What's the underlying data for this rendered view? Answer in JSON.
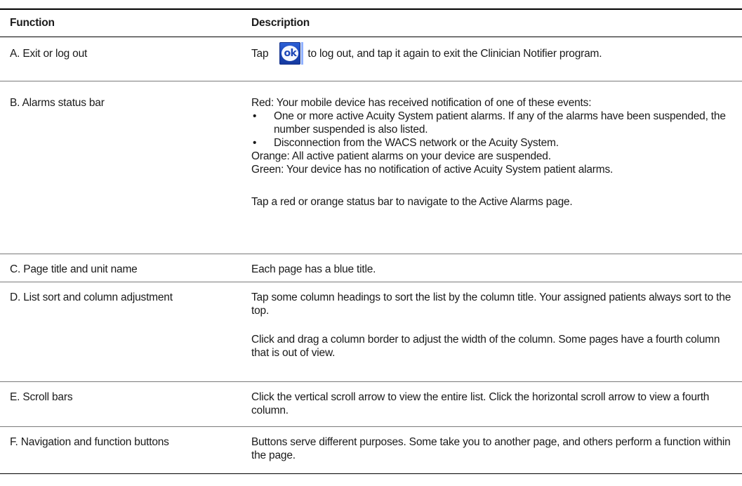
{
  "table": {
    "headers": {
      "function": "Function",
      "description": "Description"
    },
    "rows": [
      {
        "function": "A. Exit or log out",
        "desc_before": "Tap",
        "button_label": "ok",
        "desc_after": "to log out, and tap it again to exit the Clinician Notifier program."
      },
      {
        "function": "B. Alarms status bar",
        "intro": "Red: Your mobile device has received notification of one of these events:",
        "bullet_char": "•",
        "bullets": [
          "One or more active Acuity System patient alarms. If any of the alarms have been suspended, the number suspended is also listed.",
          "Disconnection from the WACS network or the Acuity System."
        ],
        "orange": "Orange: All active patient alarms on your device are suspended.",
        "green": "Green: Your device has no notification of active Acuity System patient alarms.",
        "tap_note": "Tap a red or orange status bar to navigate to the Active Alarms page."
      },
      {
        "function": "C. Page title and unit name",
        "description": "Each page has a blue title."
      },
      {
        "function": "D. List sort and column adjustment",
        "para1": "Tap some column headings to sort the list by the column title. Your assigned patients always sort to the top.",
        "para2": "Click and drag a column border to adjust the width of the column. Some pages have a fourth column that is out of view."
      },
      {
        "function": "E. Scroll bars",
        "description": "Click the vertical scroll arrow to view the entire list. Click the horizontal scroll arrow to view a fourth column."
      },
      {
        "function": "F. Navigation and function buttons",
        "description": "Buttons serve different purposes. Some take you to another page, and others perform a function within the page."
      }
    ]
  },
  "colors": {
    "ok_button": "#1b45b6",
    "rule": "#000000",
    "row_divider": "#7a7a7a"
  },
  "icons": {
    "ok_button": "ok-button-icon"
  }
}
